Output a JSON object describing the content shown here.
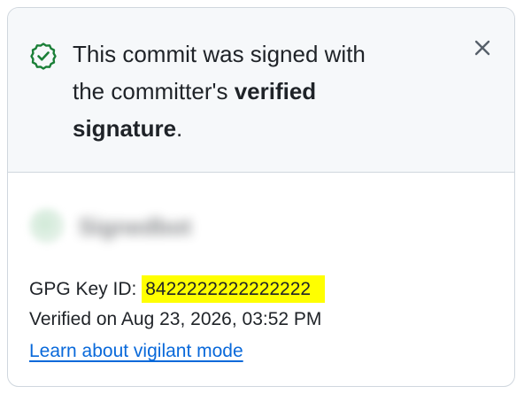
{
  "header": {
    "message_line1": "This commit was signed with",
    "message_line2": "the committer's",
    "message_bold1": "verified",
    "message_bold2": "signature",
    "message_end": ".",
    "status_color": "#1a7f37"
  },
  "signer": {
    "username": "Signedbot"
  },
  "details": {
    "key_label": "GPG Key ID:",
    "key_id": "8422222222222222",
    "verified_on": "Verified on Aug 23, 2026, 03:52 PM",
    "learn_link": "Learn about vigilant mode"
  },
  "colors": {
    "highlight": "#ffff00",
    "link": "#0969da",
    "header_bg": "#f6f8fa"
  },
  "icons": {
    "status": "verified-check-icon",
    "close": "close-icon"
  }
}
